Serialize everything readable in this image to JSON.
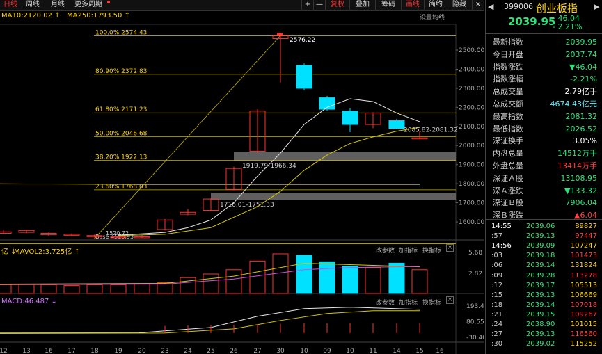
{
  "toolbar": {
    "tabs": [
      "日线",
      "周线",
      "月线",
      "更多周期"
    ],
    "buttons": [
      "+",
      "—",
      "复权",
      "叠加",
      "筹码",
      "画线",
      "简约",
      "隐藏"
    ],
    "close": "×"
  },
  "ma": {
    "ma10": "MA10:2120.02 ↑",
    "ma250": "MA250:1793.50 ↑"
  },
  "settings_label": "设置均线",
  "price_axis": [
    "2500.00",
    "2400.00",
    "2300.00",
    "2200.00",
    "2100.00",
    "2000.00",
    "1900.00",
    "1800.00",
    "1700.00",
    "1600.00"
  ],
  "fib": [
    {
      "label": "100.0% 2574.43",
      "v": 2574.43
    },
    {
      "label": "80.90% 2372.83",
      "v": 2372.83
    },
    {
      "label": "61.80% 2171.23",
      "v": 2171.23
    },
    {
      "label": "50.00% 2046.68",
      "v": 2046.68
    },
    {
      "label": "38.20% 1922.13",
      "v": 1922.13
    },
    {
      "label": "23.60% 1768.03",
      "v": 1768.03
    }
  ],
  "annotations": {
    "high": "2576.22",
    "gap1": "1919.79-1966.34",
    "gap2": "1716.01-1751.33",
    "gap3": "2085.82-2081.32",
    "low": "1520.72",
    "low2": "4516.93",
    "base": "Base"
  },
  "vol": {
    "label1": "亿 ↓",
    "label2": "MAVOL2:3.725亿 ↑",
    "axis": [
      "5.68",
      "2.82"
    ],
    "btn1": "改参数",
    "btn2": "加指标",
    "btn3": "换指标"
  },
  "macd": {
    "label": "MACD:46.487 ↓",
    "axis": [
      "193.48",
      "80.55",
      "-30.40"
    ],
    "btn1": "改参数",
    "btn2": "加指标",
    "btn3": "换指标"
  },
  "date_axis": [
    "12",
    "13",
    "16",
    "17",
    "18",
    "19",
    "20",
    "23",
    "24",
    "25",
    "26",
    "27",
    "30",
    "10",
    "09",
    "10",
    "11",
    "14",
    "15",
    "16"
  ],
  "chart_data": {
    "type": "candlestick",
    "candles": [
      {
        "o": 1540,
        "c": 1548,
        "h": 1555,
        "l": 1535
      },
      {
        "o": 1545,
        "c": 1555,
        "h": 1560,
        "l": 1540
      },
      {
        "o": 1532,
        "c": 1540,
        "h": 1545,
        "l": 1525
      },
      {
        "o": 1530,
        "c": 1535,
        "h": 1540,
        "l": 1525
      },
      {
        "o": 1525,
        "c": 1528,
        "h": 1538,
        "l": 1515
      },
      {
        "o": 1520,
        "c": 1522,
        "h": 1528,
        "l": 1516
      },
      {
        "o": 1518,
        "c": 1522,
        "h": 1530,
        "l": 1516
      },
      {
        "o": 1560,
        "c": 1610,
        "h": 1615,
        "l": 1555
      },
      {
        "o": 1640,
        "c": 1650,
        "h": 1668,
        "l": 1635
      },
      {
        "o": 1660,
        "c": 1720,
        "h": 1725,
        "l": 1655
      },
      {
        "o": 1770,
        "c": 1880,
        "h": 1890,
        "l": 1765
      },
      {
        "o": 1970,
        "c": 2180,
        "h": 2190,
        "l": 1960
      },
      {
        "o": 2560,
        "c": 2576,
        "h": 2580,
        "l": 2330
      },
      {
        "o": 2420,
        "c": 2300,
        "h": 2430,
        "l": 2290
      },
      {
        "o": 2250,
        "c": 2190,
        "h": 2260,
        "l": 2180
      },
      {
        "o": 2180,
        "c": 2110,
        "h": 2195,
        "l": 2070
      },
      {
        "o": 2110,
        "c": 2170,
        "h": 2175,
        "l": 2090
      },
      {
        "o": 2130,
        "c": 2090,
        "h": 2140,
        "l": 2085
      },
      {
        "o": 2040,
        "c": 2040,
        "h": 2075,
        "l": 2035
      }
    ],
    "volume": [
      1.2,
      1.3,
      1.2,
      1.1,
      1.2,
      1.2,
      1.3,
      1.5,
      2.2,
      2.7,
      3.3,
      4.5,
      5.5,
      5.3,
      4.4,
      3.8,
      3.6,
      4.2,
      3.3
    ],
    "ylim": [
      1500,
      2600
    ]
  },
  "quote": {
    "code": "399006",
    "name": "创业板指",
    "price": "2039.95",
    "change": "- 46.04",
    "pct": "- 2.21%",
    "rows": [
      {
        "k": "最新指数",
        "v": "2039.95",
        "c": "#2ee37a"
      },
      {
        "k": "今日开盘",
        "v": "2037.74",
        "c": "#2ee37a"
      },
      {
        "k": "指数涨跌",
        "v": "▼46.04",
        "c": "#2ee37a"
      },
      {
        "k": "指数涨幅",
        "v": "-2.21%",
        "c": "#2ee37a"
      },
      {
        "k": "总成交量",
        "v": "2.79亿手",
        "c": "#ffffff"
      },
      {
        "k": "总成交额",
        "v": "4674.43亿元",
        "c": "#5cf0ff"
      },
      {
        "k": "最高指数",
        "v": "2081.32",
        "c": "#2ee37a"
      },
      {
        "k": "最低指数",
        "v": "2026.52",
        "c": "#2ee37a"
      },
      {
        "k": "深证换手",
        "v": "3.05%",
        "c": "#ffffff"
      },
      {
        "k": "内盘总量",
        "v": "14512万手",
        "c": "#2ee37a"
      },
      {
        "k": "外盘总量",
        "v": "13414万手",
        "c": "#ff4040"
      },
      {
        "k": "深证Ａ股",
        "v": "13108.95",
        "c": "#2ee37a"
      },
      {
        "k": "深Ａ涨跌",
        "v": "▼133.32",
        "c": "#2ee37a"
      },
      {
        "k": "深证Ｂ股",
        "v": "7906.04",
        "c": "#2ee37a"
      },
      {
        "k": "深Ｂ涨跌",
        "v": "▲6.04",
        "c": "#ff4040"
      }
    ],
    "ticks": [
      {
        "t": "14:55",
        "p": "2039.06",
        "v": "89827",
        "tc": "#ffffff",
        "vc": "#ffd400"
      },
      {
        "t": ":57",
        "p": "2039.13",
        "v": "97447",
        "tc": "#ccc",
        "vc": "#ff4040"
      },
      {
        "t": "14:56",
        "p": "2039.09",
        "v": "107247",
        "tc": "#ffffff",
        "vc": "#ffd400"
      },
      {
        "t": ":03",
        "p": "2039.18",
        "v": "101473",
        "tc": "#ccc",
        "vc": "#ff4040"
      },
      {
        "t": ":06",
        "p": "2039.14",
        "v": "131824",
        "tc": "#ccc",
        "vc": "#ffd400"
      },
      {
        "t": ":09",
        "p": "2039.28",
        "v": "113278",
        "tc": "#ccc",
        "vc": "#ff4040"
      },
      {
        "t": ":12",
        "p": "2039.17",
        "v": "105513",
        "tc": "#ccc",
        "vc": "#ffd400"
      },
      {
        "t": ":15",
        "p": "2039.13",
        "v": "106669",
        "tc": "#ccc",
        "vc": "#ffd400"
      },
      {
        "t": ":18",
        "p": "2039.14",
        "v": "107018",
        "tc": "#ccc",
        "vc": "#ff4040"
      },
      {
        "t": ":21",
        "p": "2039.15",
        "v": "109267",
        "tc": "#ccc",
        "vc": "#ff4040"
      },
      {
        "t": ":24",
        "p": "2038.90",
        "v": "101015",
        "tc": "#ccc",
        "vc": "#ffd400"
      },
      {
        "t": ":27",
        "p": "2039.13",
        "v": "116560",
        "tc": "#ccc",
        "vc": "#ff4040"
      },
      {
        "t": ":30",
        "p": "2039.02",
        "v": "115252",
        "tc": "#ccc",
        "vc": "#ffd400"
      }
    ]
  }
}
